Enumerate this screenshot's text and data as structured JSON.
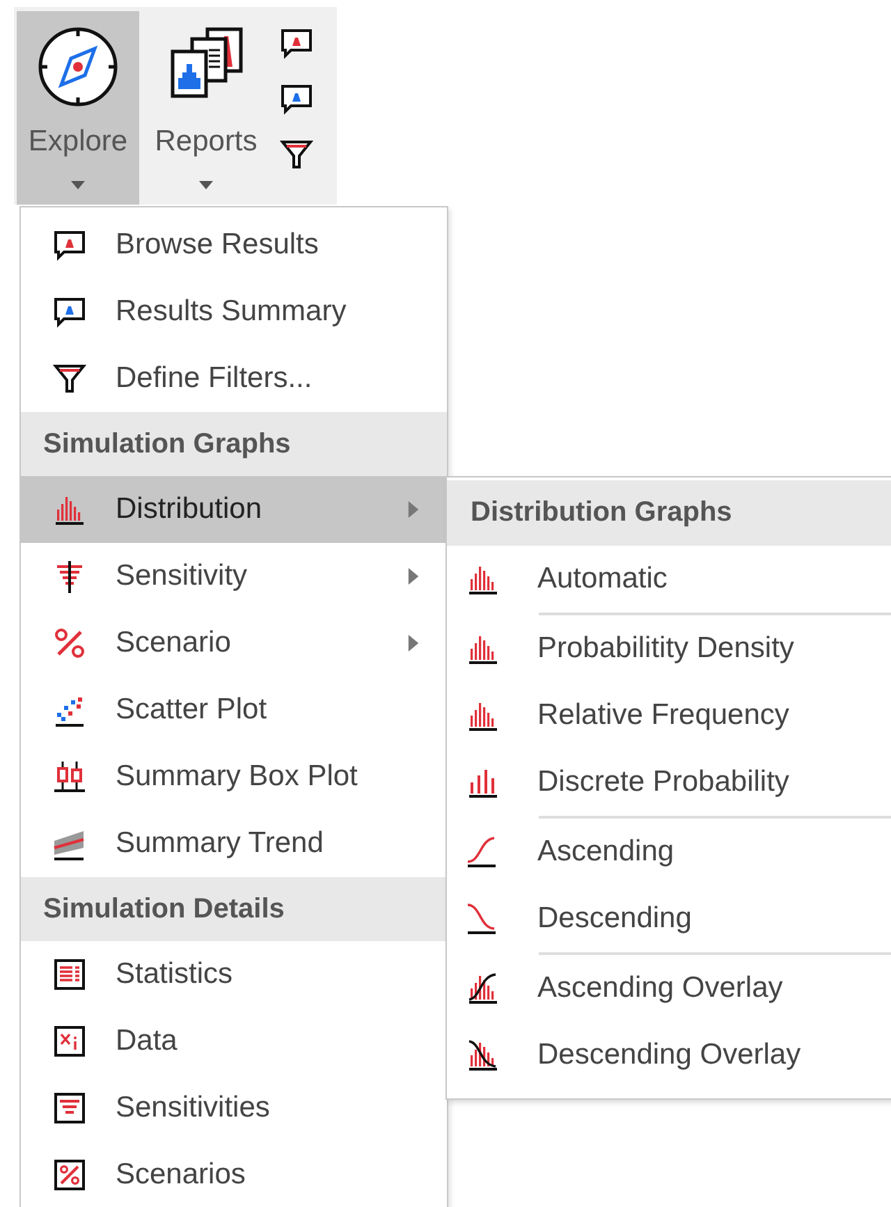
{
  "ribbon": {
    "buttons": [
      {
        "label": "Explore",
        "selected": true
      },
      {
        "label": "Reports",
        "selected": false
      }
    ]
  },
  "menu": {
    "items": [
      {
        "kind": "item",
        "label": "Browse Results",
        "submenu": false,
        "selected": false
      },
      {
        "kind": "item",
        "label": "Results Summary",
        "submenu": false,
        "selected": false
      },
      {
        "kind": "item",
        "label": "Define Filters...",
        "submenu": false,
        "selected": false
      },
      {
        "kind": "header",
        "label": "Simulation Graphs"
      },
      {
        "kind": "item",
        "label": "Distribution",
        "submenu": true,
        "selected": true
      },
      {
        "kind": "item",
        "label": "Sensitivity",
        "submenu": true,
        "selected": false
      },
      {
        "kind": "item",
        "label": "Scenario",
        "submenu": true,
        "selected": false
      },
      {
        "kind": "item",
        "label": "Scatter Plot",
        "submenu": false,
        "selected": false
      },
      {
        "kind": "item",
        "label": "Summary Box Plot",
        "submenu": false,
        "selected": false
      },
      {
        "kind": "item",
        "label": "Summary Trend",
        "submenu": false,
        "selected": false
      },
      {
        "kind": "header",
        "label": "Simulation Details"
      },
      {
        "kind": "item",
        "label": "Statistics",
        "submenu": false,
        "selected": false
      },
      {
        "kind": "item",
        "label": "Data",
        "submenu": false,
        "selected": false
      },
      {
        "kind": "item",
        "label": "Sensitivities",
        "submenu": false,
        "selected": false
      },
      {
        "kind": "item",
        "label": "Scenarios",
        "submenu": false,
        "selected": false
      }
    ]
  },
  "submenu": {
    "title": "Distribution Graphs",
    "groups": [
      [
        "Automatic"
      ],
      [
        "Probabilitity Density",
        "Relative Frequency",
        "Discrete Probability"
      ],
      [
        "Ascending",
        "Descending"
      ],
      [
        "Ascending Overlay",
        "Descending Overlay"
      ]
    ]
  }
}
